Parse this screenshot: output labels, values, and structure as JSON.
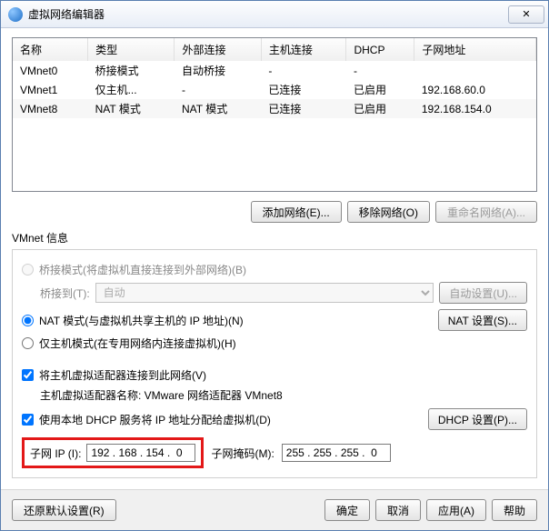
{
  "window": {
    "title": "虚拟网络编辑器"
  },
  "table": {
    "headers": [
      "名称",
      "类型",
      "外部连接",
      "主机连接",
      "DHCP",
      "子网地址"
    ],
    "rows": [
      {
        "name": "VMnet0",
        "type": "桥接模式",
        "ext": "自动桥接",
        "host": "-",
        "dhcp": "-",
        "subnet": ""
      },
      {
        "name": "VMnet1",
        "type": "仅主机...",
        "ext": "-",
        "host": "已连接",
        "dhcp": "已启用",
        "subnet": "192.168.60.0"
      },
      {
        "name": "VMnet8",
        "type": "NAT 模式",
        "ext": "NAT 模式",
        "host": "已连接",
        "dhcp": "已启用",
        "subnet": "192.168.154.0"
      }
    ]
  },
  "buttons": {
    "add_net": "添加网络(E)...",
    "remove_net": "移除网络(O)",
    "rename_net": "重命名网络(A)..."
  },
  "info": {
    "title": "VMnet 信息",
    "bridge_radio": "桥接模式(将虚拟机直接连接到外部网络)(B)",
    "bridge_to_label": "桥接到(T):",
    "bridge_to_value": "自动",
    "auto_settings": "自动设置(U)...",
    "nat_radio": "NAT 模式(与虚拟机共享主机的 IP 地址)(N)",
    "nat_settings": "NAT 设置(S)...",
    "hostonly_radio": "仅主机模式(在专用网络内连接虚拟机)(H)",
    "host_adapter_chk": "将主机虚拟适配器连接到此网络(V)",
    "host_adapter_name": "主机虚拟适配器名称: VMware 网络适配器 VMnet8",
    "dhcp_chk": "使用本地 DHCP 服务将 IP 地址分配给虚拟机(D)",
    "dhcp_settings": "DHCP 设置(P)...",
    "subnet_ip_label": "子网 IP (I):",
    "subnet_ip_value": "192 . 168 . 154 .  0",
    "subnet_mask_label": "子网掩码(M):",
    "subnet_mask_value": "255 . 255 . 255 .  0"
  },
  "footer": {
    "restore": "还原默认设置(R)",
    "ok": "确定",
    "cancel": "取消",
    "apply": "应用(A)",
    "help": "帮助"
  }
}
